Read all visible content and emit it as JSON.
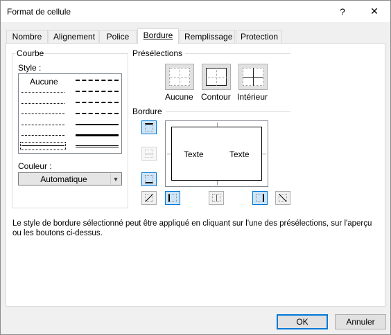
{
  "window": {
    "title": "Format de cellule",
    "help_glyph": "?",
    "close_glyph": "✕"
  },
  "tabs": [
    {
      "label": "Nombre"
    },
    {
      "label": "Alignement"
    },
    {
      "label": "Police"
    },
    {
      "label": "Bordure",
      "active": true
    },
    {
      "label": "Remplissage"
    },
    {
      "label": "Protection"
    }
  ],
  "courbe": {
    "group_label": "Courbe",
    "style_label": "Style :",
    "none_label": "Aucune",
    "color_label": "Couleur :",
    "color_value": "Automatique"
  },
  "presets": {
    "group_label": "Présélections",
    "items": [
      {
        "label": "Aucune"
      },
      {
        "label": "Contour"
      },
      {
        "label": "Intérieur"
      }
    ]
  },
  "border": {
    "group_label": "Bordure",
    "preview_text_left": "Texte",
    "preview_text_right": "Texte"
  },
  "info_text": "Le style de bordure sélectionné peut être appliqué en cliquant sur l'une des présélections, sur l'aperçu ou les boutons ci-dessus.",
  "buttons": {
    "ok": "OK",
    "cancel": "Annuler"
  },
  "colors": {
    "accent": "#0078d7",
    "selected_fill": "#cce4f7"
  }
}
